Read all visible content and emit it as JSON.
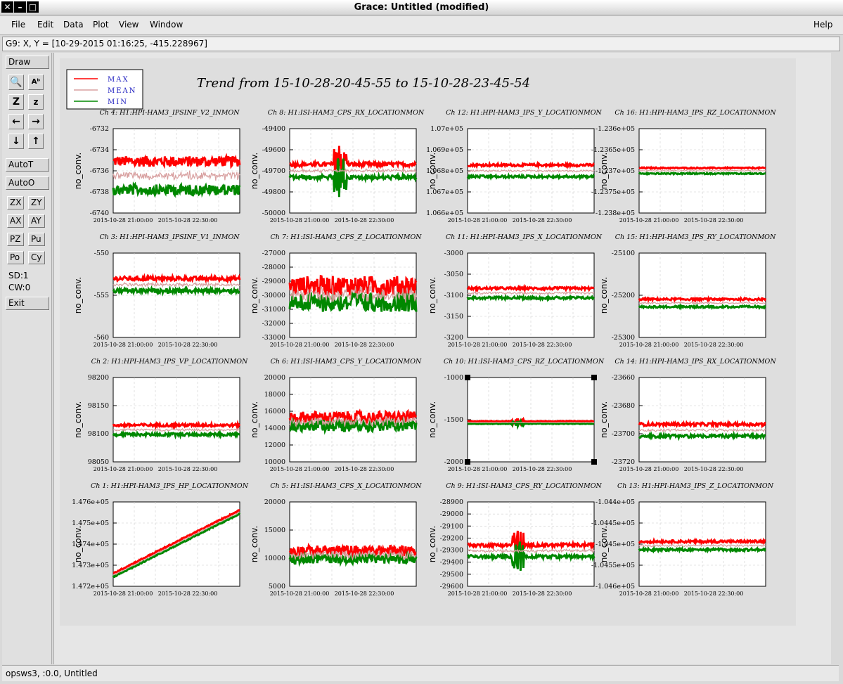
{
  "window": {
    "title": "Grace: Untitled (modified)"
  },
  "menubar": {
    "items": [
      "File",
      "Edit",
      "Data",
      "Plot",
      "View",
      "Window"
    ],
    "help": "Help"
  },
  "coordbar": {
    "text": "G9: X, Y = [10-29-2015 01:16:25, -415.228967]"
  },
  "toolbar": {
    "draw": "Draw",
    "autot": "AutoT",
    "autoo": "AutoO",
    "row_buttons": [
      [
        "ZX",
        "ZY"
      ],
      [
        "AX",
        "AY"
      ],
      [
        "PZ",
        "Pu"
      ],
      [
        "Po",
        "Cy"
      ]
    ],
    "sd": "SD:1",
    "cw": "CW:0",
    "exit": "Exit",
    "icons": [
      "zoom-icon",
      "autoscale-text-icon",
      "zoom-z-icon",
      "zoom-small-z-icon",
      "arrow-left-icon",
      "arrow-right-icon",
      "arrow-down-icon",
      "arrow-up-icon"
    ]
  },
  "statusbar": {
    "text": "opsws3, :0.0, Untitled"
  },
  "chart_data": {
    "type": "line",
    "title": "Trend from 15-10-28-20-45-55 to 15-10-28-23-45-54",
    "legend": {
      "placement": "top-left",
      "entries": [
        {
          "name": "MAX",
          "color": "#ff0000"
        },
        {
          "name": "MEAN",
          "color": "#d8a0a0"
        },
        {
          "name": "MIN",
          "color": "#008800"
        }
      ]
    },
    "x_ticks": [
      "2015-10-28 21:00:00",
      "2015-10-28 22:30:00"
    ],
    "ylabel": "no_conv.",
    "panels": [
      {
        "title": "Ch 4: H1:HPI-HAM3_IPSINF_V2_INMON",
        "ticks": [
          "-6732",
          "-6734",
          "-6736",
          "-6738",
          "-6740"
        ],
        "ylim": [
          -6740,
          -6732
        ],
        "max": -6735.3,
        "min": -6737.6,
        "noise": 0.5,
        "spike": null,
        "trend": 0
      },
      {
        "title": "Ch 8: H1:ISI-HAM3_CPS_RX_LOCATIONMON",
        "ticks": [
          "-49400",
          "-49600",
          "-49700",
          "-49800",
          "-50000"
        ],
        "ylim": [
          -50000,
          -49400
        ],
        "max": -49660,
        "min": -49740,
        "noise": 15,
        "spike": 0.4,
        "trend": 0
      },
      {
        "title": "Ch 12: H1:HPI-HAM3_IPS_Y_LOCATIONMON",
        "ticks": [
          "1.07e+05",
          "1.069e+05",
          "1.068e+05",
          "1.067e+05",
          "1.066e+05"
        ],
        "ylim": [
          106600,
          107000
        ],
        "max": 106825,
        "min": 106775,
        "noise": 6,
        "spike": null,
        "trend": 0
      },
      {
        "title": "Ch 16: H1:HPI-HAM3_IPS_RZ_LOCATIONMON",
        "ticks": [
          "-1.236e+05",
          "-1.2365e+05",
          "-1.237e+05",
          "-1.2375e+05",
          "-1.238e+05"
        ],
        "ylim": [
          -123800,
          -123600
        ],
        "max": -123694,
        "min": -123706,
        "noise": 1.5,
        "spike": null,
        "trend": 0
      },
      {
        "title": "Ch 3: H1:HPI-HAM3_IPSINF_V1_INMON",
        "ticks": [
          "-550",
          "-555",
          "-560"
        ],
        "ylim": [
          -563,
          -547
        ],
        "max": -552,
        "min": -554,
        "noise": 0.4,
        "spike": null,
        "trend": 0
      },
      {
        "title": "Ch 7: H1:ISI-HAM3_CPS_Z_LOCATIONMON",
        "ticks": [
          "-27000",
          "-28000",
          "-29000",
          "-30000",
          "-31000",
          "-32000",
          "-33000"
        ],
        "ylim": [
          -33000,
          -27000
        ],
        "max": -29600,
        "min": -30200,
        "noise": 700,
        "spike": null,
        "trend": 0
      },
      {
        "title": "Ch 11: H1:HPI-HAM3_IPS_X_LOCATIONMON",
        "ticks": [
          "-3000",
          "-3050",
          "-3100",
          "-3150",
          "-3200"
        ],
        "ylim": [
          -3200,
          -3000
        ],
        "max": -3085,
        "min": -3105,
        "noise": 3,
        "spike": null,
        "trend": 0
      },
      {
        "title": "Ch 15: H1:HPI-HAM3_IPS_RY_LOCATIONMON",
        "ticks": [
          "-25100",
          "-25200",
          "-25300"
        ],
        "ylim": [
          -25300,
          -25050
        ],
        "max": -25188,
        "min": -25208,
        "noise": 3,
        "spike": null,
        "trend": 0
      },
      {
        "title": "Ch 2: H1:HPI-HAM3_IPS_VP_LOCATIONMON",
        "ticks": [
          "98200",
          "98150",
          "98100",
          "98050"
        ],
        "ylim": [
          98050,
          98225
        ],
        "max": 98125,
        "min": 98108,
        "noise": 3,
        "spike": null,
        "trend": 0
      },
      {
        "title": "Ch 6: H1:ISI-HAM3_CPS_Y_LOCATIONMON",
        "ticks": [
          "20000",
          "18000",
          "16000",
          "14000",
          "12000",
          "10000"
        ],
        "ylim": [
          10000,
          20000
        ],
        "max": 15000,
        "min": 14600,
        "noise": 700,
        "spike": null,
        "trend": 0
      },
      {
        "title": "Ch 10: H1:ISI-HAM3_CPS_RZ_LOCATIONMON",
        "ticks": [
          "-1000",
          "-1500",
          "-2000"
        ],
        "ylim": [
          -2200,
          -700
        ],
        "max": -1480,
        "min": -1520,
        "noise": 6,
        "spike": 0.4,
        "trend": 0
      },
      {
        "title": "Ch 14: H1:HPI-HAM3_IPS_RX_LOCATIONMON",
        "ticks": [
          "-23660",
          "-23680",
          "-23700",
          "-23720"
        ],
        "ylim": [
          -23730,
          -23650
        ],
        "max": -23695,
        "min": -23705,
        "noise": 1.5,
        "spike": null,
        "trend": 0
      },
      {
        "title": "Ch 1: H1:HPI-HAM3_IPS_HP_LOCATIONMON",
        "ticks": [
          "1.476e+05",
          "1.475e+05",
          "1.474e+05",
          "1.473e+05",
          "1.472e+05"
        ],
        "ylim": [
          147200,
          147600
        ],
        "max": 147260,
        "min": 147245,
        "noise": 3,
        "spike": null,
        "trend": 300
      },
      {
        "title": "Ch 5: H1:ISI-HAM3_CPS_X_LOCATIONMON",
        "ticks": [
          "20000",
          "15000",
          "10000",
          "5000"
        ],
        "ylim": [
          5000,
          20000
        ],
        "max": 11000,
        "min": 10300,
        "noise": 900,
        "spike": null,
        "trend": 0
      },
      {
        "title": "Ch 9: H1:ISI-HAM3_CPS_RY_LOCATIONMON",
        "ticks": [
          "-28900",
          "-29000",
          "-29100",
          "-29200",
          "-29300",
          "-29400",
          "-29500",
          "-29600"
        ],
        "ylim": [
          -29600,
          -28850
        ],
        "max": -29240,
        "min": -29330,
        "noise": 15,
        "spike": 0.4,
        "trend": 0
      },
      {
        "title": "Ch 13: H1:HPI-HAM3_IPS_Z_LOCATIONMON",
        "ticks": [
          "-1.044e+05",
          "-1.0445e+05",
          "-1.045e+05",
          "-1.0455e+05",
          "-1.046e+05"
        ],
        "ylim": [
          -104600,
          -104400
        ],
        "max": -104495,
        "min": -104512,
        "noise": 3,
        "spike": null,
        "trend": 0
      }
    ]
  }
}
